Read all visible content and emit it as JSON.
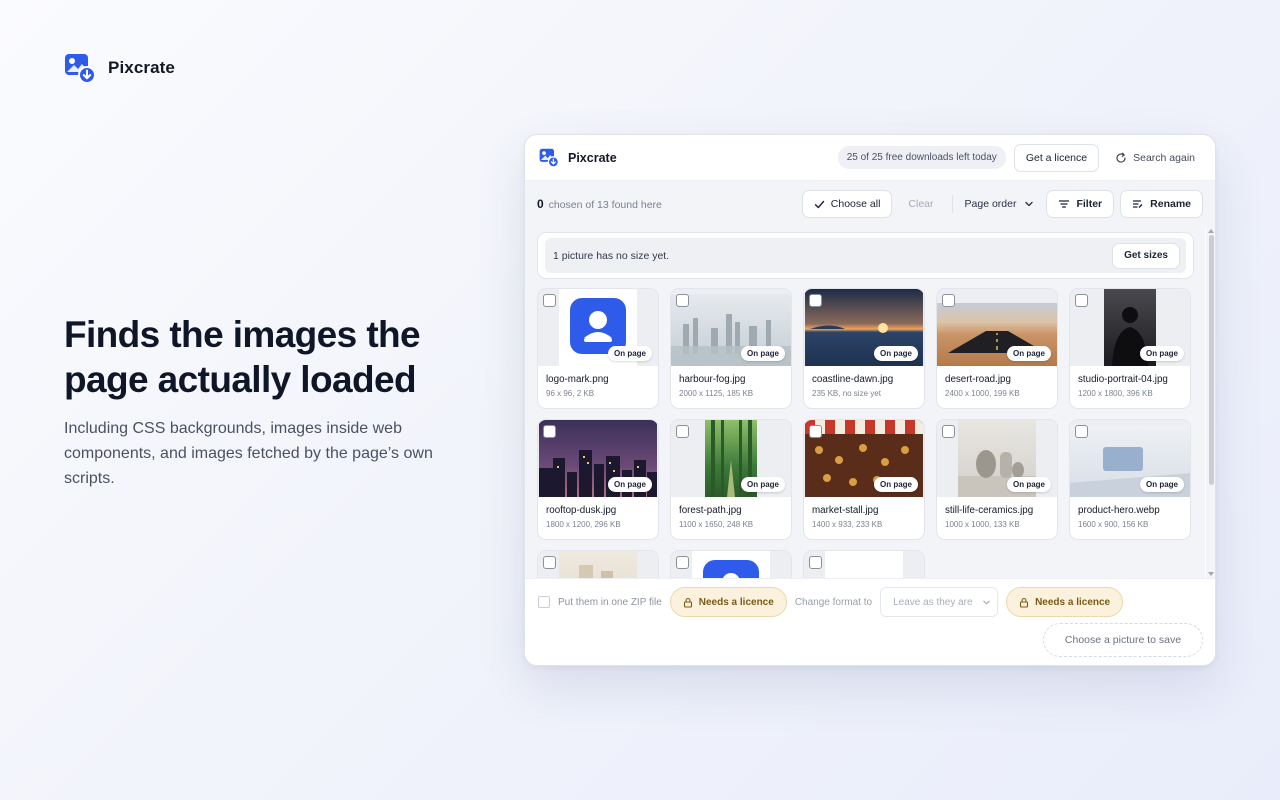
{
  "brand": {
    "name": "Pixcrate",
    "logo_icon": "picture-download-icon"
  },
  "hero": {
    "title": "Finds the images the page actually loaded",
    "subtitle": "Including CSS backgrounds, images inside web components, and images fetched by the page’s own scripts."
  },
  "panel": {
    "header": {
      "brand": "Pixcrate",
      "quota": "25 of 25 free downloads left today",
      "licence_button": "Get a licence",
      "search_again": "Search again"
    },
    "toolbar": {
      "chosen_count": "0",
      "chosen_text": "chosen of 13 found here",
      "choose_all": "Choose all",
      "clear": "Clear",
      "order": "Page order",
      "filter": "Filter",
      "rename": "Rename"
    },
    "notice": {
      "text": "1 picture has no size yet.",
      "button": "Get sizes"
    },
    "images": [
      {
        "name": "logo-mark.png",
        "meta": "96 x 96, 2 KB",
        "badge": "On page",
        "art": "logo"
      },
      {
        "name": "harbour-fog.jpg",
        "meta": "2000 x 1125, 185 KB",
        "badge": "On page",
        "art": "fog"
      },
      {
        "name": "coastline-dawn.jpg",
        "meta": "235 KB, no size yet",
        "badge": "On page",
        "art": "dawn"
      },
      {
        "name": "desert-road.jpg",
        "meta": "2400 x 1000, 199 KB",
        "badge": "On page",
        "art": "desert"
      },
      {
        "name": "studio-portrait-04.jpg",
        "meta": "1200 x 1800, 396 KB",
        "badge": "On page",
        "art": "portrait"
      },
      {
        "name": "rooftop-dusk.jpg",
        "meta": "1800 x 1200, 296 KB",
        "badge": "On page",
        "art": "dusk"
      },
      {
        "name": "forest-path.jpg",
        "meta": "1100 x 1650, 248 KB",
        "badge": "On page",
        "art": "forest"
      },
      {
        "name": "market-stall.jpg",
        "meta": "1400 x 933, 233 KB",
        "badge": "On page",
        "art": "market"
      },
      {
        "name": "still-life-ceramics.jpg",
        "meta": "1000 x 1000, 133 KB",
        "badge": "On page",
        "art": "ceramics"
      },
      {
        "name": "product-hero.webp",
        "meta": "1600 x 900, 156 KB",
        "badge": "On page",
        "art": "product"
      },
      {
        "name": "",
        "meta": "",
        "badge": "",
        "art": "beige"
      },
      {
        "name": "",
        "meta": "",
        "badge": "",
        "art": "logo"
      },
      {
        "name": "",
        "meta": "",
        "badge": "",
        "art": "blank"
      }
    ],
    "footer": {
      "zip_label": "Put them in one ZIP file",
      "licence_badge": "Needs a licence",
      "format_label": "Change format to",
      "format_value": "Leave as they are",
      "licence_badge_2": "Needs a licence",
      "save_button": "Choose a picture to save"
    }
  },
  "colors": {
    "accent": "#2f5bea",
    "licence_bg": "#fbf1dc",
    "licence_text": "#7a5a15"
  }
}
